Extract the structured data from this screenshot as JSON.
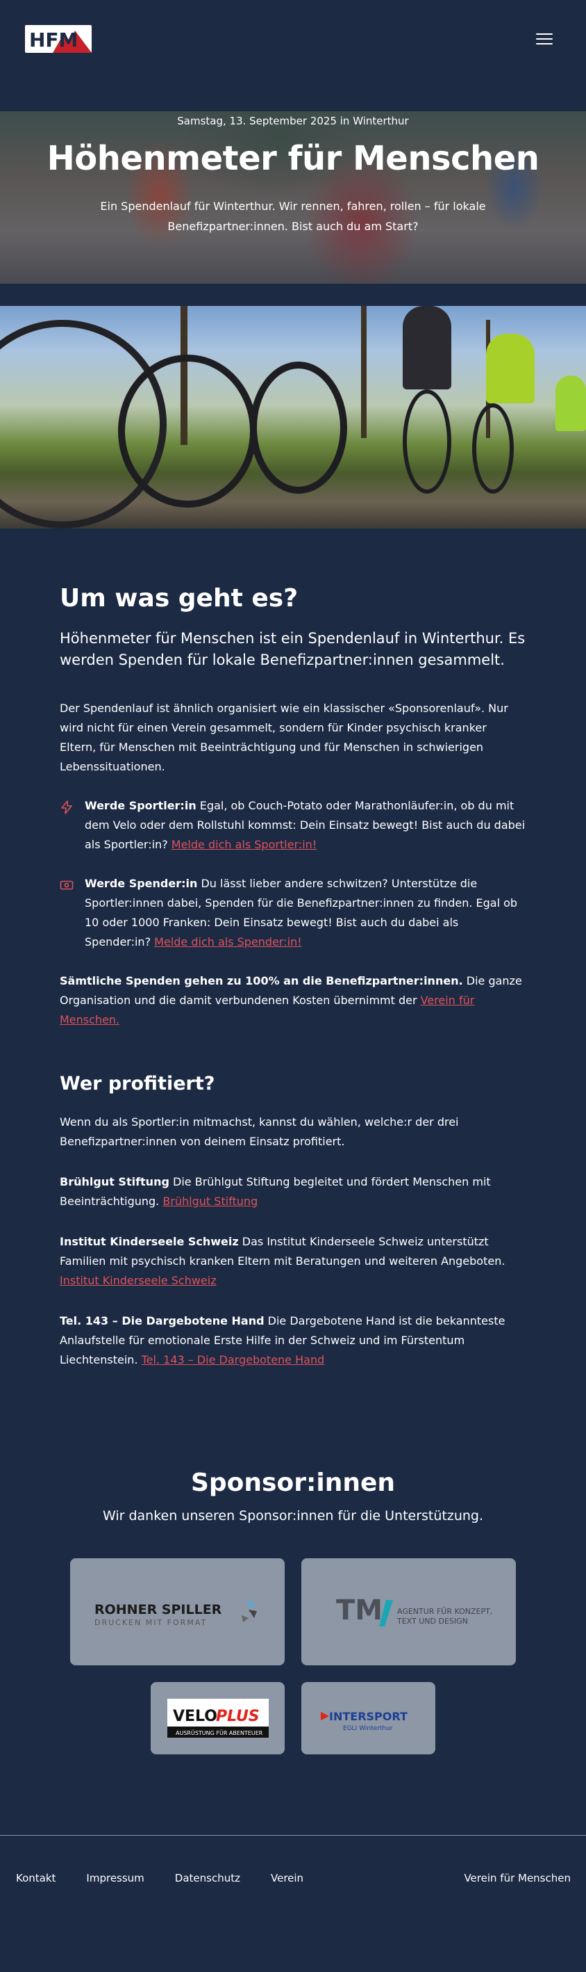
{
  "header": {
    "logo_text": "HFM",
    "menu_icon": "hamburger-menu-icon"
  },
  "hero": {
    "date": "Samstag, 13. September 2025 in Winterthur",
    "title": "Höhenmeter für Menschen",
    "subtitle": "Ein Spendenlauf für Winterthur. Wir rennen, fahren, rollen – für lokale Benefizpartner:innen. Bist auch du am Start?"
  },
  "about": {
    "heading": "Um was geht es?",
    "lead": "Höhenmeter für Menschen ist ein Spendenlauf in Winterthur. Es werden Spenden für lokale Benefizpartner:innen gesammelt.",
    "intro": "Der Spendenlauf ist ähnlich organisiert wie ein klassischer «Sponsorenlauf». Nur wird nicht für einen Verein gesammelt, sondern für Kinder psychisch kranker Eltern, für Menschen mit Beeinträchtigung und für Menschen in schwierigen Lebenssituationen.",
    "features": [
      {
        "icon": "lightning-icon",
        "title": "Werde Sportler:in",
        "text": "Egal, ob Couch-Potato oder Marathonläufer:in, ob du mit dem Velo oder dem Rollstuhl kommst: Dein Einsatz bewegt! Bist auch du dabei als Sportler:in?",
        "link": "Melde dich als Sportler:in!"
      },
      {
        "icon": "money-icon",
        "title": "Werde Spender:in",
        "text": "Du lässt lieber andere schwitzen? Unterstütze die Sportler:innen dabei, Spenden für die Benefizpartner:innen zu finden. Egal ob 10 oder 1000 Franken: Dein Einsatz bewegt! Bist auch du dabei als Spender:in?",
        "link": "Melde dich als Spender:in!"
      }
    ],
    "note_bold": "Sämtliche Spenden gehen zu 100% an die Benefizpartner:innen.",
    "note_text": "Die ganze Organisation und die damit verbundenen Kosten übernimmt der",
    "note_link": "Verein für Menschen."
  },
  "beneficiaries": {
    "heading": "Wer profitiert?",
    "intro": "Wenn du als Sportler:in mitmachst, kannst du wählen, welche:r der drei Benefizpartner:innen von deinem Einsatz profitiert.",
    "items": [
      {
        "name": "Brühlgut Stiftung",
        "text": "Die Brühlgut Stiftung begleitet und fördert Menschen mit Beeinträchtigung.",
        "link": "Brühlgut Stiftung"
      },
      {
        "name": "Institut Kinderseele Schweiz",
        "text": "Das Institut Kinderseele Schweiz unterstützt Familien mit psychisch kranken Eltern mit Beratungen und weiteren Angeboten.",
        "link": "Institut Kinderseele Schweiz"
      },
      {
        "name": "Tel. 143 – Die Dargebotene Hand",
        "text": "Die Dargebotene Hand ist die bekannteste Anlaufstelle für emotionale Erste Hilfe in der Schweiz und im Fürstentum Liechtenstein.",
        "link": "Tel. 143 – Die Dargebotene Hand"
      }
    ]
  },
  "sponsors": {
    "heading": "Sponsor:innen",
    "subtitle": "Wir danken unseren Sponsor:innen für die Unterstützung.",
    "logos": [
      {
        "name": "ROHNER SPILLER",
        "tagline": "DRUCKEN MIT FORMAT"
      },
      {
        "name": "TM",
        "tagline_1": "AGENTUR FÜR KONZEPT,",
        "tagline_2": "TEXT UND DESIGN"
      },
      {
        "name_a": "VELO",
        "name_b": "PLUS",
        "tagline": "AUSRÜSTUNG FÜR ABENTEUER"
      },
      {
        "name": "INTERSPORT",
        "tagline": "EGLI Winterthur"
      }
    ],
    "colors": {
      "card": "#8e97a5",
      "veloplus_red": "#e2231a",
      "intersport_blue": "#1b3f94"
    }
  },
  "footer": {
    "links": [
      "Kontakt",
      "Impressum",
      "Datenschutz",
      "Verein"
    ],
    "right": "Verein für Menschen"
  },
  "colors": {
    "background": "#1c2a44",
    "accent": "#e0525a",
    "text": "#ffffff"
  }
}
